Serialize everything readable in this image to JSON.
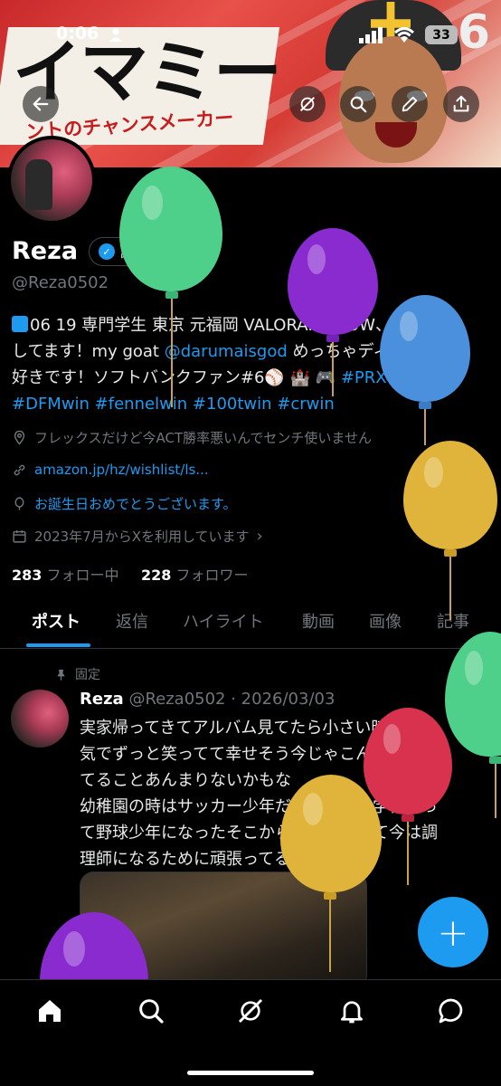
{
  "status_bar": {
    "time": "0:06",
    "battery": "33"
  },
  "banner": {
    "title_big": "イマミー",
    "title_sub": "ントのチャンスメーカー",
    "number": "6"
  },
  "profile": {
    "name": "Reza",
    "verify_label": "認証を受ける",
    "handle": "@Reza0502",
    "bio_1": "06 19 専門学生 東京 元福岡 VALORANT、OW、APEX",
    "bio_2a": "してます！my goat ",
    "bio_2_mention": "@darumaisgod",
    "bio_2b": " めっちゃディズニー",
    "bio_3a": "好きです！ソフトバンクファン#6⚾ 🏰 🎮 ",
    "bio_3_tag": "#PRXWIN",
    "bio_4": "#DFMwin #fennelwin #100twin #crwin",
    "location": "フレックスだけど今ACT勝率悪いんでセンチ使いません",
    "website": "amazon.jp/hz/wishlist/ls...",
    "birthday": "お誕生日おめでとうございます。",
    "joined": "2023年7月からXを利用しています",
    "following_count": "283",
    "following_label": "フォロー中",
    "followers_count": "228",
    "followers_label": "フォロワー"
  },
  "tabs": [
    "ポスト",
    "返信",
    "ハイライト",
    "動画",
    "画像",
    "記事"
  ],
  "post": {
    "pinned_label": "固定",
    "author": "Reza",
    "handle_date": "@Reza0502 · 2026/03/03",
    "line_1": "実家帰ってきてアルバム見てたら小さい時は無邪",
    "line_2": "気でずっと笑ってて幸せそう今じゃこんなに笑っ",
    "line_3": "てることあんまりないかもな",
    "line_4": "幼稚園の時はサッカー少年だったのに小学校入っ",
    "line_5": "て野球少年になったそこから高一でやめて今は調",
    "line_6": "理師になるために頑張ってる"
  },
  "fab": {
    "label": "+"
  },
  "colors": {
    "accent": "#1d9bf0",
    "background": "#000000",
    "muted": "#71767b"
  },
  "icons": [
    "back-arrow-icon",
    "grok-icon",
    "search-icon",
    "edit-icon",
    "share-icon",
    "home-icon",
    "explore-icon",
    "notifications-icon",
    "messages-icon"
  ]
}
